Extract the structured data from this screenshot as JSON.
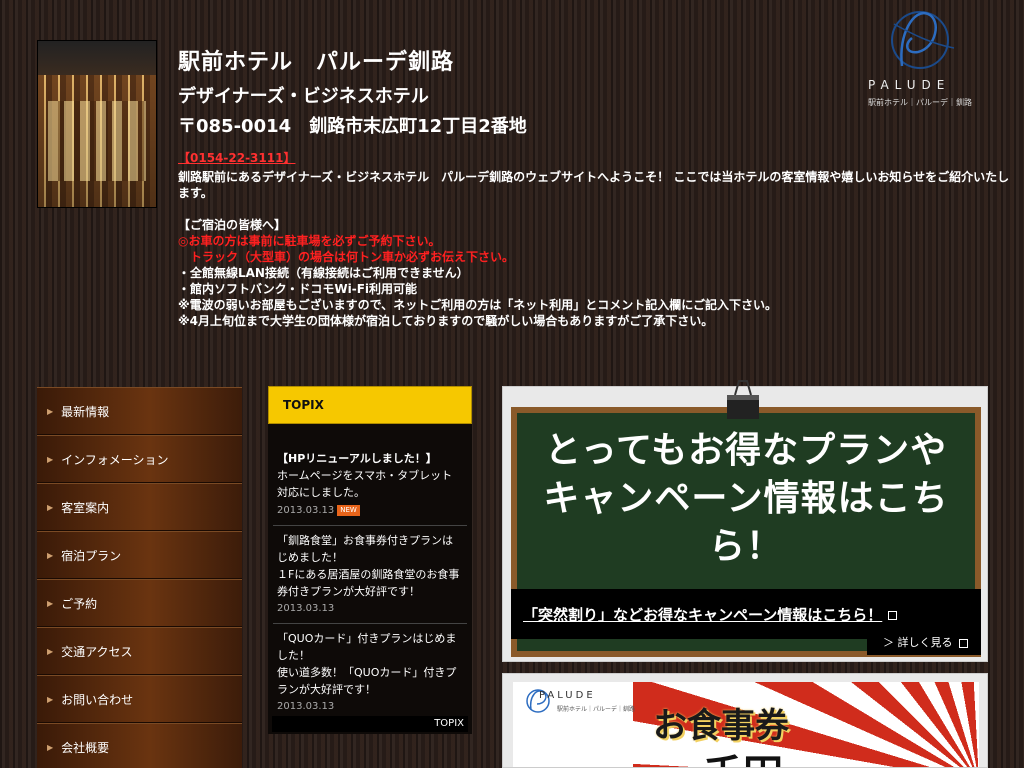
{
  "header": {
    "hotel_name": "駅前ホテル　パルーデ釧路",
    "subtitle": "デザイナーズ・ビジネスホテル",
    "address": "〒085-0014　釧路市末広町12丁目2番地",
    "phone": "【0154-22-3111】",
    "intro": "釧路駅前にあるデザイナーズ・ビジネスホテル　パルーデ釧路のウェブサイトへようこそ！ ここでは当ホテルの客室情報や嬉しいお知らせをご紹介いたします。",
    "notice_title": "【ご宿泊の皆様へ】",
    "notice_red_1": "◎お車の方は事前に駐車場を必ずご予約下さい。",
    "notice_red_2": "　トラック（大型車）の場合は何トン車か必ずお伝え下さい。",
    "notice_3": "・全館無線LAN接続（有線接続はご利用できません）",
    "notice_4": "・館内ソフトバンク・ドコモWi-Fi利用可能",
    "notice_5": "※電波の弱いお部屋もございますので、ネットご利用の方は「ネット利用」とコメント記入欄にご記入下さい。",
    "notice_6": "※4月上旬位まで大学生の団体様が宿泊しておりますので騒がしい場合もありますがご了承下さい。"
  },
  "logo": {
    "text": "PALUDE",
    "sub": "駅前ホテル｜パルーデ｜釧路"
  },
  "nav": {
    "items": [
      {
        "label": "最新情報"
      },
      {
        "label": "インフォメーション"
      },
      {
        "label": "客室案内"
      },
      {
        "label": "宿泊プラン"
      },
      {
        "label": "ご予約"
      },
      {
        "label": "交通アクセス"
      },
      {
        "label": "お問い合わせ"
      },
      {
        "label": "会社概要"
      }
    ],
    "arrow": "▶"
  },
  "topix": {
    "title": "TOPIX",
    "entries": [
      {
        "title": "【HPリニューアルしました！】",
        "body": "ホームページをスマホ・タブレット対応にしました。",
        "date": "2013.03.13",
        "badge": "NEW"
      },
      {
        "title": "「釧路食堂」お食事券付きプランはじめました！",
        "body": "１Fにある居酒屋の釧路食堂のお食事券付きプランが大好評です！",
        "date": "2013.03.13"
      },
      {
        "title": "「QUOカード」付きプランはじめました！",
        "body": "使い道多数！「QUOカード」付きプランが大好評です！",
        "date": "2013.03.13"
      }
    ],
    "footer": "TOPIX"
  },
  "banner1": {
    "board_line1": "とってもお得なプランや",
    "board_line2": "キャンペーン情報はこちら！",
    "caption": "「突然割り」などお得なキャンペーン情報はこちら！",
    "more": "＞ 詳しく見る"
  },
  "banner2": {
    "title": "お食事券",
    "big": "千円",
    "logo": "PALUDE",
    "logo_sub": "駅前ホテル｜パルーデ｜釧路"
  }
}
